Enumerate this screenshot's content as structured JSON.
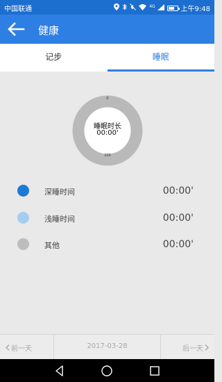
{
  "status_bar": {
    "carrier": "中国联通",
    "icons": [
      "location-icon",
      "bluetooth-icon",
      "mute-icon",
      "wifi-icon",
      "signal-icon",
      "battery-icon"
    ],
    "signal_label": "4G",
    "time": "上午9:48",
    "battery_level": 0.7
  },
  "app_bar": {
    "title": "健康",
    "back_icon": "arrow-left-icon"
  },
  "tabs": [
    {
      "label": "记步",
      "active": false
    },
    {
      "label": "睡眠",
      "active": true
    }
  ],
  "gauge": {
    "label": "睡眠时长",
    "value": "00:00'",
    "scale_min": "0",
    "scale_max": "100",
    "ring_color": "#b9b9b9"
  },
  "legend": [
    {
      "label": "深睡时间",
      "value": "00:00'",
      "color": "#1c7ad6"
    },
    {
      "label": "浅睡时间",
      "value": "00:00'",
      "color": "#a6cdee"
    },
    {
      "label": "其他",
      "value": "00:00'",
      "color": "#bdbdbd"
    }
  ],
  "date_nav": {
    "prev": "前一天",
    "date": "2017-03-28",
    "next": "后一天"
  },
  "colors": {
    "accent": "#2e7fe3",
    "status_bar": "#1c6ecf"
  }
}
